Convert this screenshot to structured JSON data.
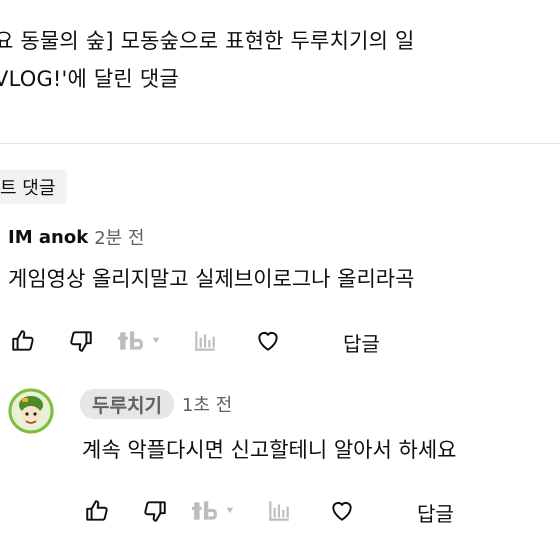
{
  "video": {
    "title": "요 동물의 숲] 모동숲으로 표현한 두루치기의 일\nVLOG!'에 달린 댓글"
  },
  "filter": {
    "chip_label": "트 댓글"
  },
  "comments": [
    {
      "author": "IM anok",
      "time": "2분 전",
      "text": "게임영상 올리지말고 실제브이로그나 올리라곡",
      "reply_label": "답글"
    }
  ],
  "reply": {
    "author": "두루치기",
    "time": "1초 전",
    "text": "계속 악플다시면 신고할테니 알아서 하세요",
    "reply_label": "답글"
  },
  "icons": {
    "like": "thumbs-up-icon",
    "dislike": "thumbs-down-icon",
    "translate": "translate-icon",
    "stats": "analytics-icon",
    "heart": "heart-icon",
    "avatar": "channel-avatar"
  },
  "colors": {
    "text": "#0f0f0f",
    "secondary": "#606060",
    "chip_bg": "#f2f2f2",
    "badge_bg": "#e6e6e6",
    "divider": "#e5e5e5"
  }
}
